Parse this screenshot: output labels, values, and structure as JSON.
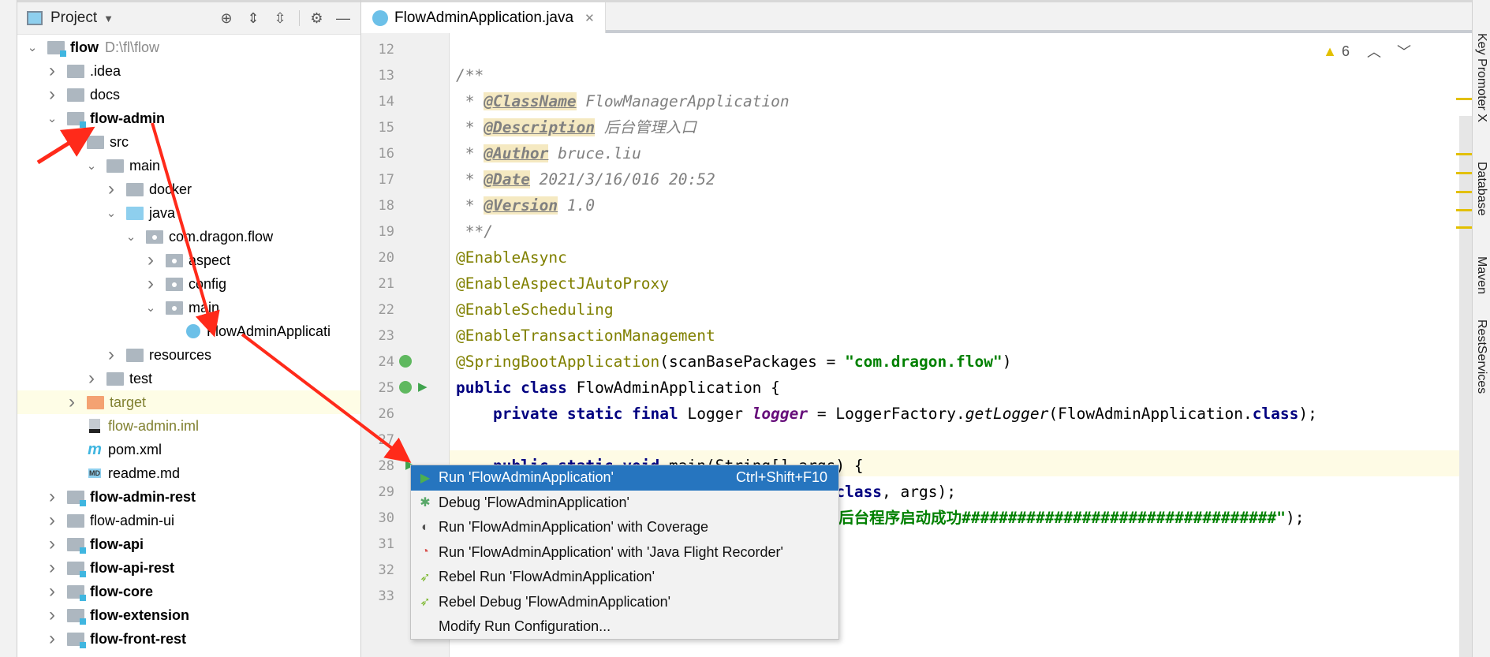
{
  "project_panel": {
    "title": "Project",
    "rows": [
      {
        "label": "flow",
        "extra": "D:\\fl\\flow",
        "bold": true,
        "depth": 0,
        "chev": "v",
        "icon": "folder mod"
      },
      {
        "label": ".idea",
        "depth": 1,
        "chev": ">",
        "icon": "folder"
      },
      {
        "label": "docs",
        "depth": 1,
        "chev": ">",
        "icon": "folder"
      },
      {
        "label": "flow-admin",
        "bold": true,
        "depth": 1,
        "chev": "v",
        "icon": "folder mod"
      },
      {
        "label": "src",
        "depth": 2,
        "chev": "v",
        "icon": "folder"
      },
      {
        "label": "main",
        "depth": 3,
        "chev": "v",
        "icon": "folder"
      },
      {
        "label": "docker",
        "depth": 4,
        "chev": ">",
        "icon": "folder"
      },
      {
        "label": "java",
        "depth": 4,
        "chev": "v",
        "icon": "folder blue"
      },
      {
        "label": "com.dragon.flow",
        "depth": 5,
        "chev": "v",
        "icon": "folder pkg"
      },
      {
        "label": "aspect",
        "depth": 6,
        "chev": ">",
        "icon": "folder pkg"
      },
      {
        "label": "config",
        "depth": 6,
        "chev": ">",
        "icon": "folder pkg"
      },
      {
        "label": "main",
        "depth": 6,
        "chev": "v",
        "icon": "folder pkg"
      },
      {
        "label": "FlowAdminApplicati",
        "depth": 7,
        "chev": "",
        "icon": "spring-class"
      },
      {
        "label": "resources",
        "depth": 4,
        "chev": ">",
        "icon": "folder"
      },
      {
        "label": "test",
        "depth": 3,
        "chev": ">",
        "icon": "folder"
      },
      {
        "label": "target",
        "depth": 2,
        "chev": ">",
        "icon": "folder orange",
        "highlight": true,
        "olive": true
      },
      {
        "label": "flow-admin.iml",
        "depth": 2,
        "chev": "",
        "icon": "iml",
        "olive": true
      },
      {
        "label": "pom.xml",
        "depth": 2,
        "chev": "",
        "icon": "maven"
      },
      {
        "label": "readme.md",
        "depth": 2,
        "chev": "",
        "icon": "md"
      },
      {
        "label": "flow-admin-rest",
        "bold": true,
        "depth": 1,
        "chev": ">",
        "icon": "folder mod"
      },
      {
        "label": "flow-admin-ui",
        "depth": 1,
        "chev": ">",
        "icon": "folder"
      },
      {
        "label": "flow-api",
        "bold": true,
        "depth": 1,
        "chev": ">",
        "icon": "folder mod"
      },
      {
        "label": "flow-api-rest",
        "bold": true,
        "depth": 1,
        "chev": ">",
        "icon": "folder mod"
      },
      {
        "label": "flow-core",
        "bold": true,
        "depth": 1,
        "chev": ">",
        "icon": "folder mod"
      },
      {
        "label": "flow-extension",
        "bold": true,
        "depth": 1,
        "chev": ">",
        "icon": "folder mod"
      },
      {
        "label": "flow-front-rest",
        "bold": true,
        "depth": 1,
        "chev": ">",
        "icon": "folder mod"
      }
    ]
  },
  "editor": {
    "tab_label": "FlowAdminApplication.java",
    "warning_count": "6",
    "lines": [
      {
        "n": "12",
        "tokens": []
      },
      {
        "n": "13",
        "tokens": [
          {
            "t": "/**",
            "c": "cm"
          }
        ]
      },
      {
        "n": "14",
        "tokens": [
          {
            "t": " * ",
            "c": "cm"
          },
          {
            "t": "@ClassName",
            "c": "tag"
          },
          {
            "t": " FlowManagerApplication",
            "c": "cm"
          }
        ]
      },
      {
        "n": "15",
        "tokens": [
          {
            "t": " * ",
            "c": "cm"
          },
          {
            "t": "@Description",
            "c": "tag"
          },
          {
            "t": " 后台管理入口",
            "c": "cm"
          }
        ]
      },
      {
        "n": "16",
        "tokens": [
          {
            "t": " * ",
            "c": "cm"
          },
          {
            "t": "@Author",
            "c": "tag"
          },
          {
            "t": " bruce.liu",
            "c": "cm"
          }
        ]
      },
      {
        "n": "17",
        "tokens": [
          {
            "t": " * ",
            "c": "cm"
          },
          {
            "t": "@Date",
            "c": "tag"
          },
          {
            "t": " 2021/3/16/016 20:52",
            "c": "cm"
          }
        ]
      },
      {
        "n": "18",
        "tokens": [
          {
            "t": " * ",
            "c": "cm"
          },
          {
            "t": "@Version",
            "c": "tag"
          },
          {
            "t": " 1.0",
            "c": "cm"
          }
        ]
      },
      {
        "n": "19",
        "tokens": [
          {
            "t": " **/",
            "c": "cm"
          }
        ]
      },
      {
        "n": "20",
        "tokens": [
          {
            "t": "@EnableAsync",
            "c": "ann"
          }
        ]
      },
      {
        "n": "21",
        "tokens": [
          {
            "t": "@EnableAspectJAutoProxy",
            "c": "ann"
          }
        ]
      },
      {
        "n": "22",
        "tokens": [
          {
            "t": "@EnableScheduling",
            "c": "ann"
          }
        ]
      },
      {
        "n": "23",
        "tokens": [
          {
            "t": "@EnableTransactionManagement",
            "c": "ann"
          }
        ]
      },
      {
        "n": "24",
        "tokens": [
          {
            "t": "@SpringBootApplication",
            "c": "ann"
          },
          {
            "t": "(scanBasePackages = ",
            "c": "pl"
          },
          {
            "t": "\"com.dragon.flow\"",
            "c": "str"
          },
          {
            "t": ")",
            "c": "pl"
          }
        ]
      },
      {
        "n": "25",
        "tokens": [
          {
            "t": "public class ",
            "c": "kw"
          },
          {
            "t": "FlowAdminApplication {",
            "c": "pl"
          }
        ]
      },
      {
        "n": "26",
        "tokens": [
          {
            "t": "    private static final ",
            "c": "kw"
          },
          {
            "t": "Logger ",
            "c": "pl"
          },
          {
            "t": "logger",
            "c": "fld"
          },
          {
            "t": " = LoggerFactory.",
            "c": "pl"
          },
          {
            "t": "getLogger",
            "c": "it"
          },
          {
            "t": "(FlowAdminApplication.",
            "c": "pl"
          },
          {
            "t": "class",
            "c": "kw"
          },
          {
            "t": ");",
            "c": "pl"
          }
        ]
      },
      {
        "n": "27",
        "tokens": []
      },
      {
        "n": "28",
        "tokens": [
          {
            "t": "    public static void ",
            "c": "kw"
          },
          {
            "t": "main(String[] args) {",
            "c": "pl"
          }
        ]
      },
      {
        "n": "29",
        "tokens": [
          {
            "t": "                              ",
            "c": "pl"
          },
          {
            "t": "pplication.",
            "c": "pl"
          },
          {
            "t": "class",
            "c": "kw"
          },
          {
            "t": ", args);",
            "c": "pl"
          }
        ]
      },
      {
        "n": "30",
        "tokens": [
          {
            "t": "                              ",
            "c": "pl"
          },
          {
            "t": "########流程后台程序启动成功##################################\"",
            "c": "str"
          },
          {
            "t": ");",
            "c": "pl"
          }
        ]
      },
      {
        "n": "31",
        "tokens": []
      },
      {
        "n": "32",
        "tokens": []
      },
      {
        "n": "33",
        "tokens": []
      }
    ]
  },
  "context_menu": {
    "items": [
      {
        "icon": "run-icon",
        "label": "Run 'FlowAdminApplication'",
        "shortcut": "Ctrl+Shift+F10",
        "selected": true
      },
      {
        "icon": "debug-icon",
        "label": "Debug 'FlowAdminApplication'"
      },
      {
        "icon": "coverage-icon",
        "label": "Run 'FlowAdminApplication' with Coverage"
      },
      {
        "icon": "flight-recorder-icon",
        "label": "Run 'FlowAdminApplication' with 'Java Flight Recorder'"
      },
      {
        "icon": "rebel-run-icon",
        "label": "Rebel Run 'FlowAdminApplication'"
      },
      {
        "icon": "rebel-debug-icon",
        "label": "Rebel Debug 'FlowAdminApplication'"
      },
      {
        "icon": "",
        "label": "Modify Run Configuration..."
      }
    ]
  },
  "right_toolbar": {
    "tabs": [
      "Key Promoter X",
      "Database",
      "Maven",
      "RestServices"
    ]
  },
  "colors": {
    "selection": "#2675bf",
    "annotation_arrow": "#ff2a1a",
    "warning": "#e2c000"
  }
}
